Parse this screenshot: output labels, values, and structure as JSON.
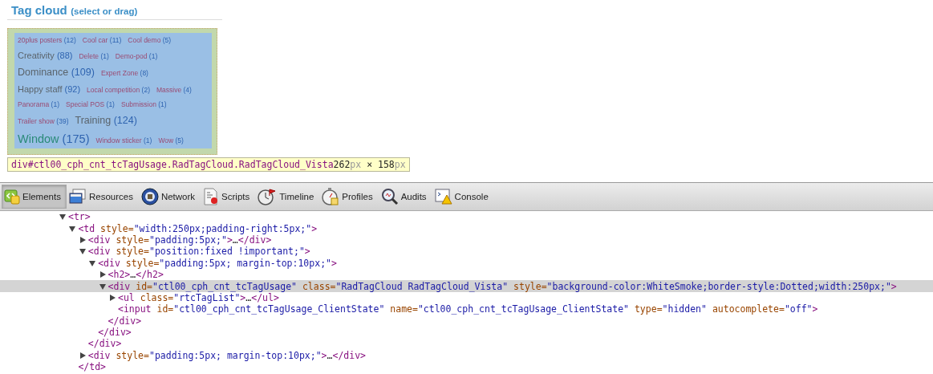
{
  "tag_cloud": {
    "title": "Tag cloud",
    "subtitle": "(select or drag)",
    "rows": [
      [
        {
          "name": "20plus posters",
          "count": "(12)",
          "kind": "small"
        },
        {
          "name": "Cool car",
          "count": "(11)",
          "kind": "small"
        },
        {
          "name": "Cool demo",
          "count": "(5)",
          "kind": "small"
        }
      ],
      [
        {
          "name": "Creativity",
          "count": "(88)",
          "kind": "large"
        },
        {
          "name": "Delete",
          "count": "(1)",
          "kind": "small"
        },
        {
          "name": "Demo-pod",
          "count": "(1)",
          "kind": "small"
        }
      ],
      [
        {
          "name": "Dominance",
          "count": "(109)",
          "kind": "xlarge"
        },
        {
          "name": "Expert Zone",
          "count": "(8)",
          "kind": "small"
        }
      ],
      [
        {
          "name": "Happy staff",
          "count": "(92)",
          "kind": "large"
        },
        {
          "name": "Local competition",
          "count": "(2)",
          "kind": "small"
        },
        {
          "name": "Massive",
          "count": "(4)",
          "kind": "small"
        }
      ],
      [
        {
          "name": "Panorama",
          "count": "(1)",
          "kind": "small"
        },
        {
          "name": "Special POS",
          "count": "(1)",
          "kind": "small"
        },
        {
          "name": "Submission",
          "count": "(1)",
          "kind": "small"
        }
      ],
      [
        {
          "name": "Trailer show",
          "count": "(39)",
          "kind": "small"
        },
        {
          "name": "Training",
          "count": "(124)",
          "kind": "xlarge"
        }
      ],
      [
        {
          "name": "Window",
          "count": "(175)",
          "kind": "huge"
        },
        {
          "name": "Window sticker",
          "count": "(1)",
          "kind": "small"
        },
        {
          "name": "Wow",
          "count": "(5)",
          "kind": "small"
        }
      ]
    ]
  },
  "tooltip": [
    {
      "kind": "selector",
      "text": "div#ctl00_cph_cnt_tcTagUsage.RadTagCloud.RadTagCloud_Vista"
    },
    {
      "kind": "number",
      "text": "262"
    },
    {
      "kind": "unit",
      "text": "px"
    },
    {
      "kind": "number",
      "text": " × 158"
    },
    {
      "kind": "unit",
      "text": "px"
    }
  ],
  "toolbar": [
    {
      "label": "Elements",
      "selected": true
    },
    {
      "label": "Resources",
      "selected": false
    },
    {
      "label": "Network",
      "selected": false
    },
    {
      "label": "Scripts",
      "selected": false
    },
    {
      "label": "Timeline",
      "selected": false
    },
    {
      "label": "Profiles",
      "selected": false
    },
    {
      "label": "Audits",
      "selected": false
    },
    {
      "label": "Console",
      "selected": false
    }
  ],
  "dom_tree": [
    {
      "open": [
        {
          "kind": "tag",
          "text": "<tr>"
        }
      ],
      "expanded": true,
      "selected": false,
      "children": [
        {
          "open": [
            {
              "kind": "tag",
              "text": "<td"
            },
            {
              "kind": "attr",
              "text": " style="
            },
            {
              "kind": "value",
              "text": "\"width:250px;padding-right:5px;\""
            },
            {
              "kind": "tag",
              "text": ">"
            }
          ],
          "expanded": true,
          "selected": false,
          "close": [
            {
              "kind": "tag",
              "text": "</td>"
            }
          ],
          "children": [
            {
              "open": [
                {
                  "kind": "tag",
                  "text": "<div"
                },
                {
                  "kind": "attr",
                  "text": " style="
                },
                {
                  "kind": "value",
                  "text": "\"padding:5px;\""
                },
                {
                  "kind": "tag",
                  "text": ">"
                },
                {
                  "kind": "text",
                  "text": "…"
                },
                {
                  "kind": "tag",
                  "text": "</div>"
                }
              ],
              "expanded": false,
              "selected": false
            },
            {
              "open": [
                {
                  "kind": "tag",
                  "text": "<div"
                },
                {
                  "kind": "attr",
                  "text": " style="
                },
                {
                  "kind": "value",
                  "text": "\"position:fixed !important;\""
                },
                {
                  "kind": "tag",
                  "text": ">"
                }
              ],
              "expanded": true,
              "selected": false,
              "close": [
                {
                  "kind": "tag",
                  "text": "</div>"
                }
              ],
              "children": [
                {
                  "open": [
                    {
                      "kind": "tag",
                      "text": "<div"
                    },
                    {
                      "kind": "attr",
                      "text": " style="
                    },
                    {
                      "kind": "value",
                      "text": "\"padding:5px; margin-top:10px;\""
                    },
                    {
                      "kind": "tag",
                      "text": ">"
                    }
                  ],
                  "expanded": true,
                  "selected": false,
                  "close": [
                    {
                      "kind": "tag",
                      "text": "</div>"
                    }
                  ],
                  "children": [
                    {
                      "open": [
                        {
                          "kind": "tag",
                          "text": "<h2>"
                        },
                        {
                          "kind": "text",
                          "text": "…"
                        },
                        {
                          "kind": "tag",
                          "text": "</h2>"
                        }
                      ],
                      "expanded": false,
                      "selected": false
                    },
                    {
                      "open": [
                        {
                          "kind": "tag",
                          "text": "<div"
                        },
                        {
                          "kind": "attr",
                          "text": " id="
                        },
                        {
                          "kind": "value",
                          "text": "\"ctl00_cph_cnt_tcTagUsage\""
                        },
                        {
                          "kind": "attr",
                          "text": " class="
                        },
                        {
                          "kind": "value",
                          "text": "\"RadTagCloud RadTagCloud_Vista\""
                        },
                        {
                          "kind": "attr",
                          "text": " style="
                        },
                        {
                          "kind": "value",
                          "text": "\"background-color:WhiteSmoke;border-style:Dotted;width:250px;\""
                        },
                        {
                          "kind": "tag",
                          "text": ">"
                        }
                      ],
                      "expanded": true,
                      "selected": true,
                      "close": [
                        {
                          "kind": "tag",
                          "text": "</div>"
                        }
                      ],
                      "children": [
                        {
                          "open": [
                            {
                              "kind": "tag",
                              "text": "<ul"
                            },
                            {
                              "kind": "attr",
                              "text": " class="
                            },
                            {
                              "kind": "value",
                              "text": "\"rtcTagList\""
                            },
                            {
                              "kind": "tag",
                              "text": ">"
                            },
                            {
                              "kind": "text",
                              "text": "…"
                            },
                            {
                              "kind": "tag",
                              "text": "</ul>"
                            }
                          ],
                          "expanded": false,
                          "selected": false
                        },
                        {
                          "open": [
                            {
                              "kind": "tag",
                              "text": "<input"
                            },
                            {
                              "kind": "attr",
                              "text": " id="
                            },
                            {
                              "kind": "value",
                              "text": "\"ctl00_cph_cnt_tcTagUsage_ClientState\""
                            },
                            {
                              "kind": "attr",
                              "text": " name="
                            },
                            {
                              "kind": "value",
                              "text": "\"ctl00_cph_cnt_tcTagUsage_ClientState\""
                            },
                            {
                              "kind": "attr",
                              "text": " type="
                            },
                            {
                              "kind": "value",
                              "text": "\"hidden\""
                            },
                            {
                              "kind": "attr",
                              "text": " autocomplete="
                            },
                            {
                              "kind": "value",
                              "text": "\"off\""
                            },
                            {
                              "kind": "tag",
                              "text": ">"
                            }
                          ],
                          "selected": false
                        }
                      ]
                    }
                  ]
                }
              ]
            },
            {
              "open": [
                {
                  "kind": "tag",
                  "text": "<div"
                },
                {
                  "kind": "attr",
                  "text": " style="
                },
                {
                  "kind": "value",
                  "text": "\"padding:5px; margin-top:10px;\""
                },
                {
                  "kind": "tag",
                  "text": ">"
                },
                {
                  "kind": "text",
                  "text": "…"
                },
                {
                  "kind": "tag",
                  "text": "</div>"
                }
              ],
              "expanded": false,
              "selected": false
            }
          ]
        }
      ]
    }
  ]
}
